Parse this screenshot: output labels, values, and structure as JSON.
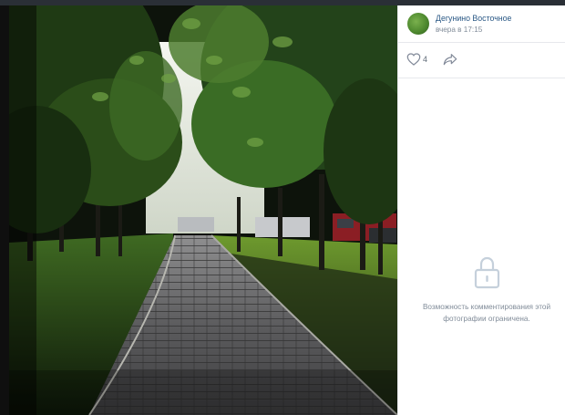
{
  "photo": {
    "description_icon": "photo-park-alley"
  },
  "post": {
    "author": "Дегунино Восточное",
    "time": "вчера в 17:15",
    "likes": "4"
  },
  "icons": {
    "like": "heart-icon",
    "share": "share-arrow-icon",
    "lock": "lock-icon"
  },
  "comments": {
    "notice_line1": "Возможность комментирования этой",
    "notice_line2": "фотографии ограничена."
  },
  "colors": {
    "link": "#2a5885",
    "muted": "#818c99",
    "icon": "#828a99"
  }
}
